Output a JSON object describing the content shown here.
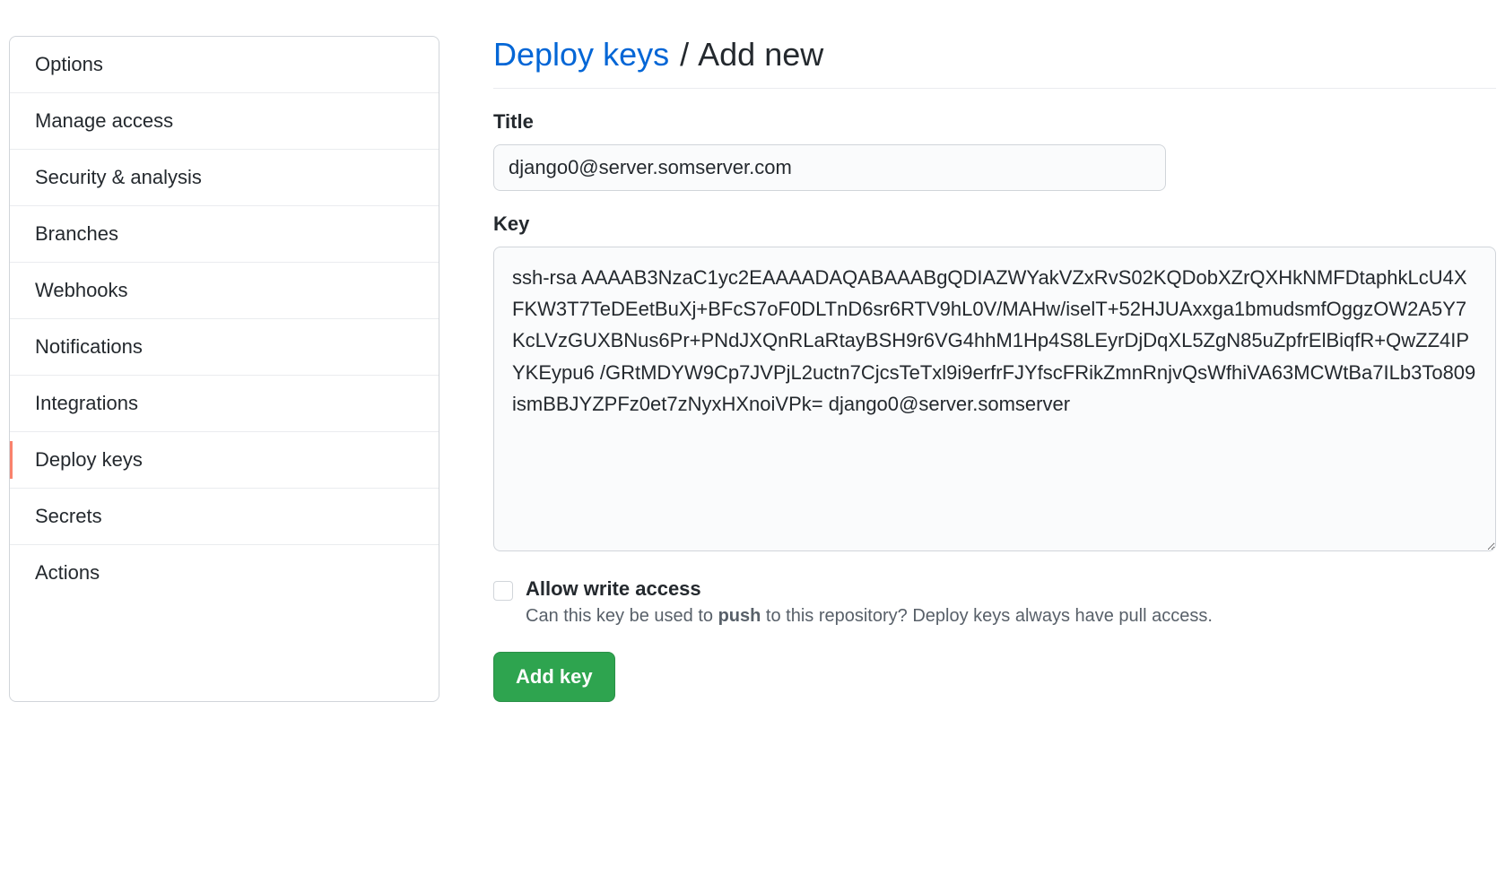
{
  "sidebar": {
    "items": [
      {
        "label": "Options",
        "selected": false
      },
      {
        "label": "Manage access",
        "selected": false
      },
      {
        "label": "Security & analysis",
        "selected": false
      },
      {
        "label": "Branches",
        "selected": false
      },
      {
        "label": "Webhooks",
        "selected": false
      },
      {
        "label": "Notifications",
        "selected": false
      },
      {
        "label": "Integrations",
        "selected": false
      },
      {
        "label": "Deploy keys",
        "selected": true
      },
      {
        "label": "Secrets",
        "selected": false
      },
      {
        "label": "Actions",
        "selected": false
      }
    ]
  },
  "header": {
    "breadcrumb_link": "Deploy keys",
    "slash": "/",
    "current": "Add new"
  },
  "form": {
    "title_label": "Title",
    "title_value": "django0@server.somserver.com",
    "key_label": "Key",
    "key_value": "ssh-rsa AAAAB3NzaC1yc2EAAAADAQABAAABgQDIAZWYakVZxRvS02KQDobXZrQXHkNMFDtaphkLcU4XFKW3T7TeDEetBuXj+BFcS7oF0DLTnD6sr6RTV9hL0V/MAHw/iselT+52HJUAxxga1bmudsmfOggzOW2A5Y7KcLVzGUXBNus6Pr+PNdJXQnRLaRtayBSH9r6VG4hhM1Hp4S8LEyrDjDqXL5ZgN85uZpfrElBiqfR+QwZZ4IPYKEypu6 /GRtMDYW9Cp7JVPjL2uctn7CjcsTeTxl9i9erfrFJYfscFRikZmnRnjvQsWfhiVA63MCWtBa7ILb3To809ismBBJYZPFz0et7zNyxHXnoiVPk= django0@server.somserver",
    "allow_write_label": "Allow write access",
    "allow_write_hint_pre": "Can this key be used to ",
    "allow_write_hint_bold": "push",
    "allow_write_hint_post": " to this repository? Deploy keys always have pull access.",
    "submit_label": "Add key"
  }
}
